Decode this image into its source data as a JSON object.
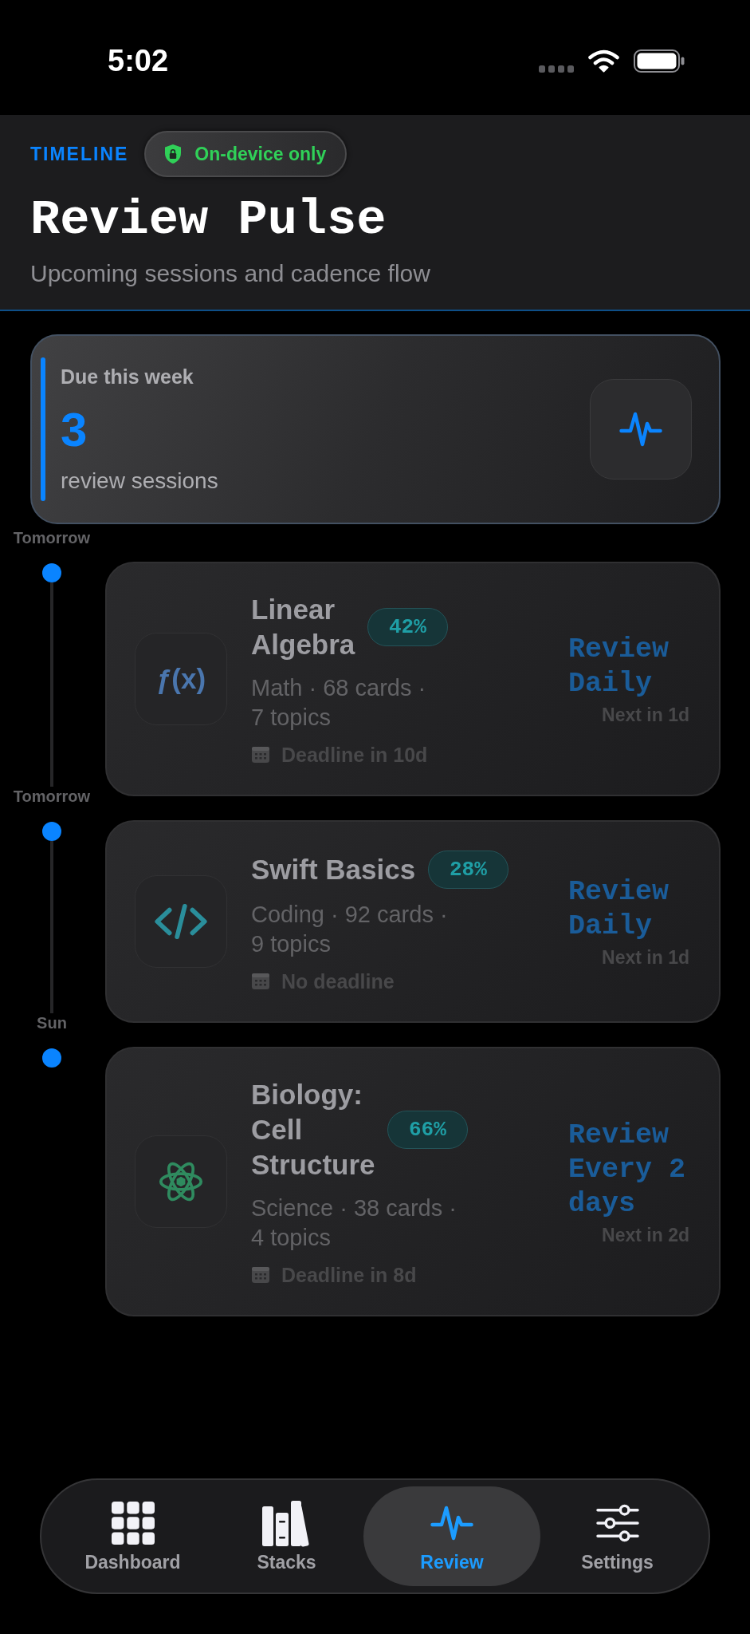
{
  "status_bar": {
    "time": "5:02"
  },
  "header": {
    "eyebrow": "TIMELINE",
    "badge": "On-device only",
    "title": "Review Pulse",
    "subtitle": "Upcoming sessions and cadence flow"
  },
  "summary": {
    "label": "Due this week",
    "count": "3",
    "caption": "review sessions"
  },
  "sessions": [
    {
      "when": "Tomorrow",
      "kind": "glyph",
      "symbol": "ƒ(x)",
      "title": "Linear Algebra",
      "progress": "42%",
      "meta": "Math · 68 cards · 7 topics",
      "deadline": "Deadline in 10d",
      "cadence": "Review Daily",
      "next": "Next in 1d"
    },
    {
      "when": "Tomorrow",
      "kind": "code",
      "title": "Swift Basics",
      "progress": "28%",
      "meta": "Coding · 92 cards · 9 topics",
      "deadline": "No deadline",
      "cadence": "Review Daily",
      "next": "Next in 1d"
    },
    {
      "when": "Sun",
      "kind": "atom",
      "title": "Biology: Cell Structure",
      "progress": "66%",
      "meta": "Science · 38 cards · 4 topics",
      "deadline": "Deadline in 8d",
      "cadence": "Review Every 2 days",
      "next": "Next in 2d"
    }
  ],
  "tab_bar": {
    "tabs": [
      {
        "label": "Dashboard",
        "selected": false
      },
      {
        "label": "Stacks",
        "selected": false
      },
      {
        "label": "Review",
        "selected": true
      },
      {
        "label": "Settings",
        "selected": false
      }
    ]
  }
}
